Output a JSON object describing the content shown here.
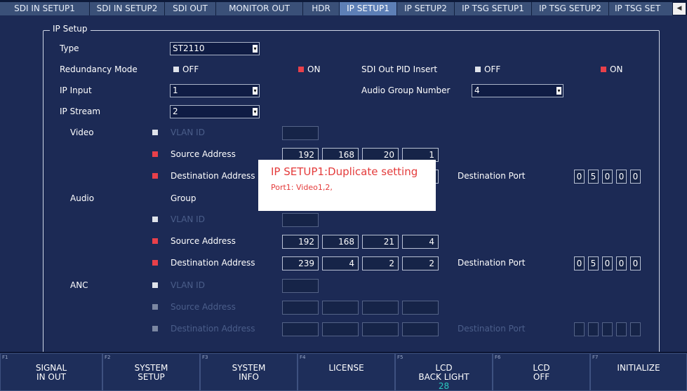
{
  "tabs": [
    "SDI IN SETUP1",
    "SDI IN SETUP2",
    "SDI OUT",
    "MONITOR OUT",
    "HDR",
    "IP SETUP1",
    "IP SETUP2",
    "IP TSG SETUP1",
    "IP TSG SETUP2",
    "IP TSG SET"
  ],
  "active_tab": "IP SETUP1",
  "panel": {
    "legend": "IP Setup",
    "type_label": "Type",
    "type_value": "ST2110",
    "redundancy_label": "Redundancy Mode",
    "off": "OFF",
    "on": "ON",
    "sdi_pid_label": "SDI Out PID Insert",
    "ip_input_label": "IP Input",
    "ip_input_value": "1",
    "audio_group_label": "Audio Group Number",
    "audio_group_value": "4",
    "ip_stream_label": "IP Stream",
    "ip_stream_value": "2",
    "video_label": "Video",
    "audio_label": "Audio",
    "anc_label": "ANC",
    "vlan_label": "VLAN ID",
    "src_label": "Source Address",
    "dst_label": "Destination Address",
    "dst_port_label": "Destination Port",
    "group_label": "Group",
    "video_src": [
      "192",
      "168",
      "20",
      "1"
    ],
    "audio_src": [
      "192",
      "168",
      "21",
      "4"
    ],
    "audio_dst": [
      "239",
      "4",
      "2",
      "2"
    ],
    "video_port": [
      "0",
      "5",
      "0",
      "0",
      "0"
    ],
    "audio_port": [
      "0",
      "5",
      "0",
      "0",
      "0"
    ]
  },
  "popup": {
    "title": "IP SETUP1:Duplicate setting",
    "message": "Port1: Video1,2,"
  },
  "fkeys": [
    {
      "num": "F1",
      "l1": "SIGNAL",
      "l2": "IN OUT",
      "l3": ""
    },
    {
      "num": "F2",
      "l1": "SYSTEM",
      "l2": "SETUP",
      "l3": ""
    },
    {
      "num": "F3",
      "l1": "SYSTEM",
      "l2": "INFO",
      "l3": ""
    },
    {
      "num": "F4",
      "l1": "LICENSE",
      "l2": "",
      "l3": ""
    },
    {
      "num": "F5",
      "l1": "LCD",
      "l2": "BACK LIGHT",
      "l3": "28"
    },
    {
      "num": "F6",
      "l1": "LCD",
      "l2": "OFF",
      "l3": ""
    },
    {
      "num": "F7",
      "l1": "INITIALIZE",
      "l2": "",
      "l3": ""
    }
  ],
  "colors": {
    "checkbox_on": "#e8404a",
    "popup_text": "#e43b3b",
    "active_tab": "#5d7fb6",
    "value_cyan": "#2ac8c0"
  }
}
